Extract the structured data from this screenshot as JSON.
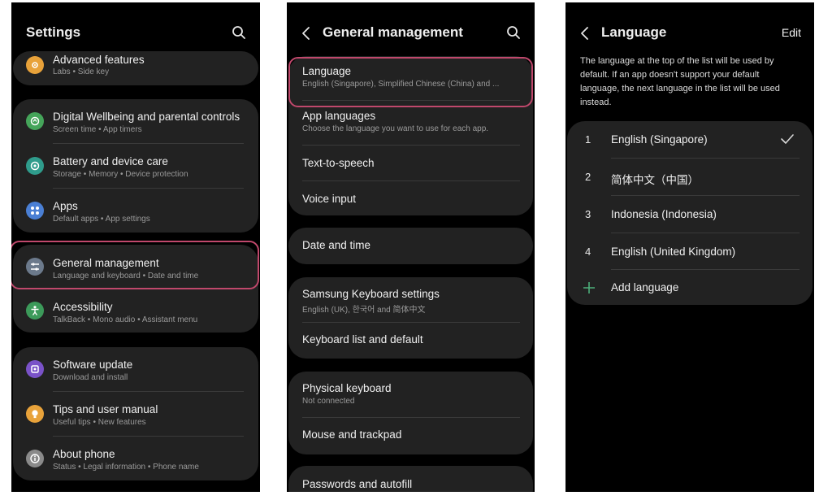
{
  "settings": {
    "title": "Settings",
    "items": [
      {
        "label": "Advanced features",
        "sub": "Labs • Side key",
        "icon": "advanced-features-icon",
        "color": "#e8a23a"
      },
      {
        "label": "Digital Wellbeing and parental controls",
        "sub": "Screen time • App timers",
        "icon": "wellbeing-icon",
        "color": "#45a55a"
      },
      {
        "label": "Battery and device care",
        "sub": "Storage • Memory • Device protection",
        "icon": "device-care-icon",
        "color": "#2f9c8c"
      },
      {
        "label": "Apps",
        "sub": "Default apps • App settings",
        "icon": "apps-icon",
        "color": "#4a7fd4"
      },
      {
        "label": "General management",
        "sub": "Language and keyboard • Date and time",
        "icon": "sliders-icon",
        "color": "#6c7a8c"
      },
      {
        "label": "Accessibility",
        "sub": "TalkBack • Mono audio • Assistant menu",
        "icon": "accessibility-icon",
        "color": "#3c9a5a"
      },
      {
        "label": "Software update",
        "sub": "Download and install",
        "icon": "software-update-icon",
        "color": "#7a52c8"
      },
      {
        "label": "Tips and user manual",
        "sub": "Useful tips • New features",
        "icon": "tips-icon",
        "color": "#e8a23a"
      },
      {
        "label": "About phone",
        "sub": "Status • Legal information • Phone name",
        "icon": "info-icon",
        "color": "#8a8a8a"
      }
    ]
  },
  "general": {
    "title": "General management",
    "items": [
      {
        "label": "Language",
        "sub": "English (Singapore), Simplified Chinese (China) and ..."
      },
      {
        "label": "App languages",
        "sub": "Choose the language you want to use for each app."
      },
      {
        "label": "Text-to-speech"
      },
      {
        "label": "Voice input"
      },
      {
        "label": "Date and time"
      },
      {
        "label": "Samsung Keyboard settings",
        "sub": "English (UK), 한국어 and 简体中文"
      },
      {
        "label": "Keyboard list and default"
      },
      {
        "label": "Physical keyboard",
        "sub": "Not connected"
      },
      {
        "label": "Mouse and trackpad"
      },
      {
        "label": "Passwords and autofill"
      }
    ]
  },
  "language": {
    "title": "Language",
    "edit": "Edit",
    "description": "The language at the top of the list will be used by default. If an app doesn't support your default language, the next language in the list will be used instead.",
    "languages": [
      {
        "num": "1",
        "name": "English (Singapore)",
        "selected": true
      },
      {
        "num": "2",
        "name": "简体中文（中国）"
      },
      {
        "num": "3",
        "name": "Indonesia (Indonesia)"
      },
      {
        "num": "4",
        "name": "English (United Kingdom)"
      }
    ],
    "add": "Add language"
  },
  "colors": {
    "highlight": "#c0486c",
    "accent_plus": "#4caf7a"
  }
}
